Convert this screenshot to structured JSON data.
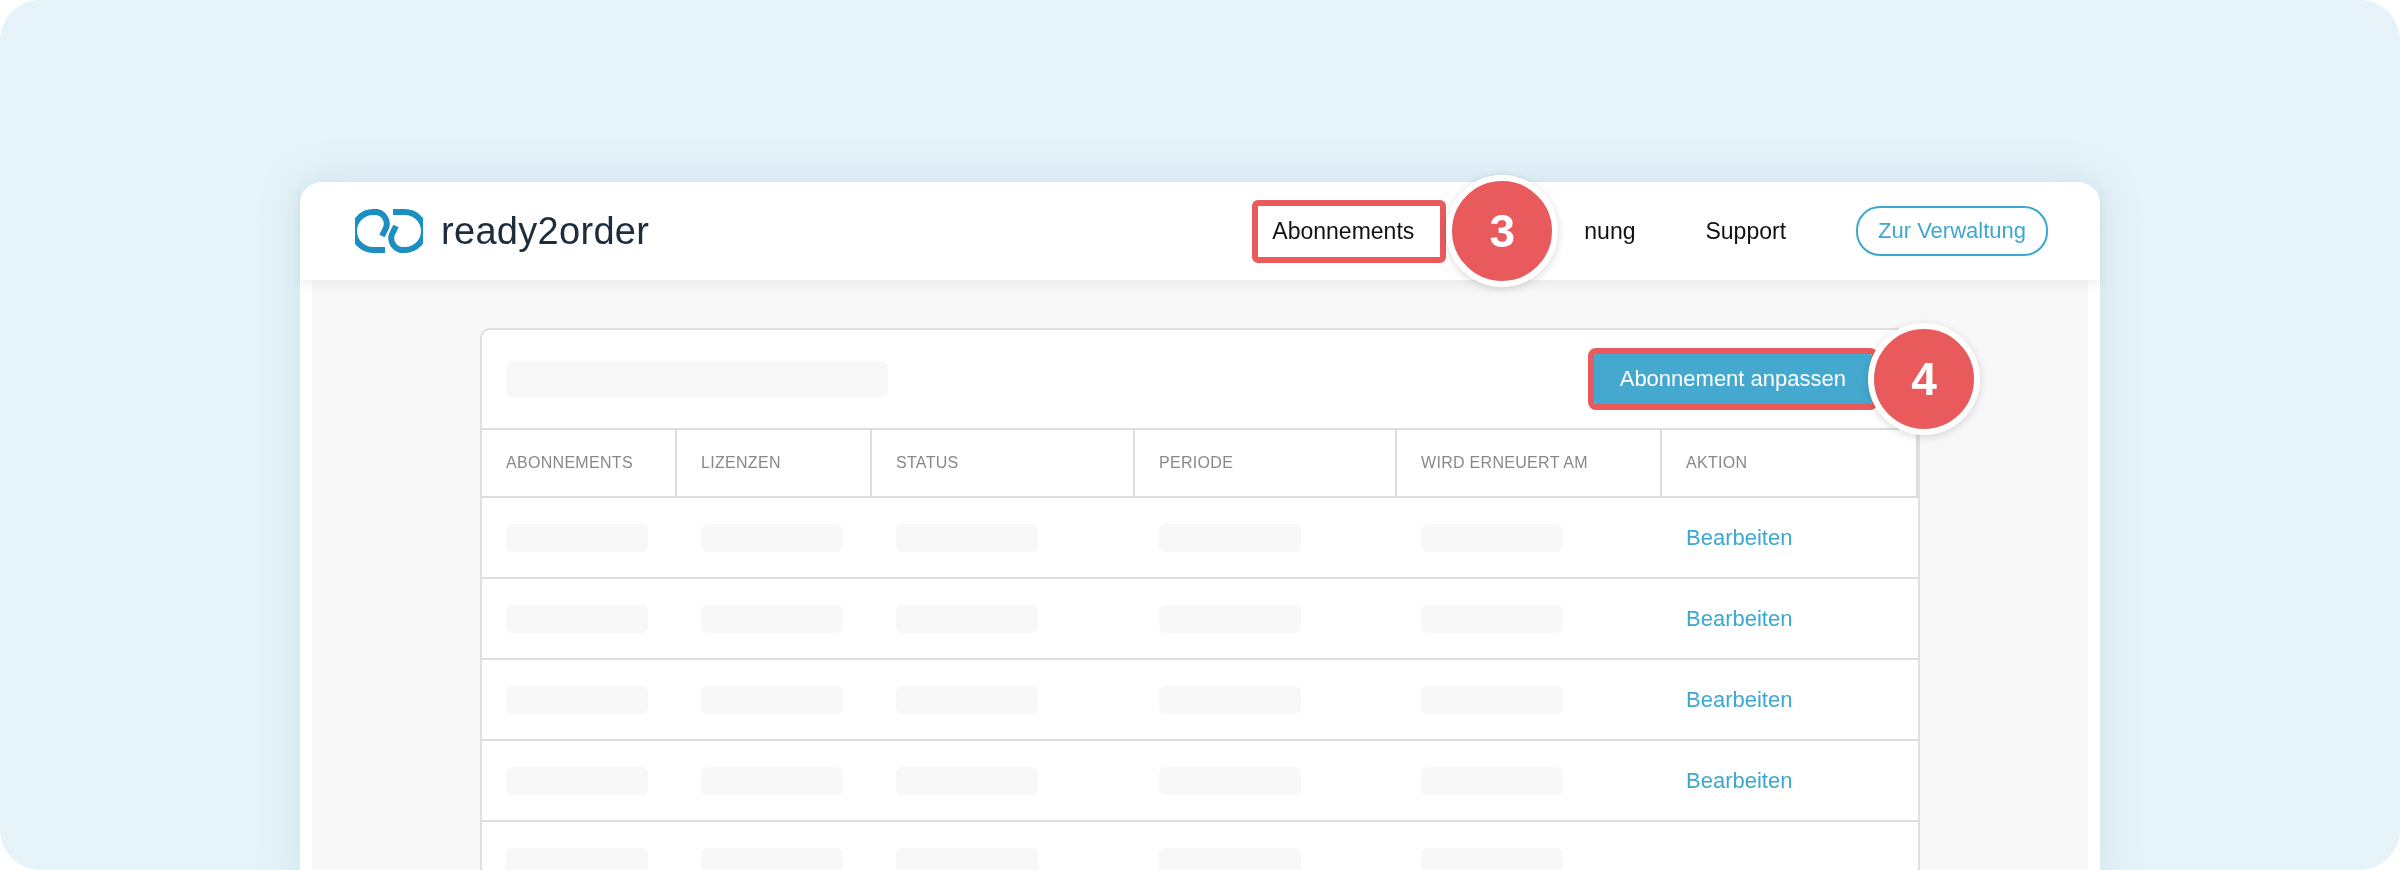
{
  "header": {
    "logo_text": "ready2order",
    "nav": [
      {
        "label": "Abonnements",
        "highlighted": true,
        "callout": "3"
      },
      {
        "label": "nung",
        "highlighted": false
      },
      {
        "label": "Support",
        "highlighted": false
      }
    ],
    "button": "Zur Verwaltung"
  },
  "card": {
    "button": {
      "label": "Abonnement anpassen",
      "highlighted": true,
      "callout": "4"
    },
    "columns": [
      "ABONNEMENTS",
      "LIZENZEN",
      "STATUS",
      "PERIODE",
      "WIRD ERNEUERT AM",
      "AKTION"
    ],
    "rows": [
      {
        "kind": "loading",
        "action": "Bearbeiten"
      },
      {
        "kind": "loading",
        "action": "Bearbeiten"
      },
      {
        "kind": "loading",
        "action": "Bearbeiten"
      },
      {
        "kind": "loading",
        "action": "Bearbeiten"
      },
      {
        "kind": "loading"
      }
    ]
  }
}
